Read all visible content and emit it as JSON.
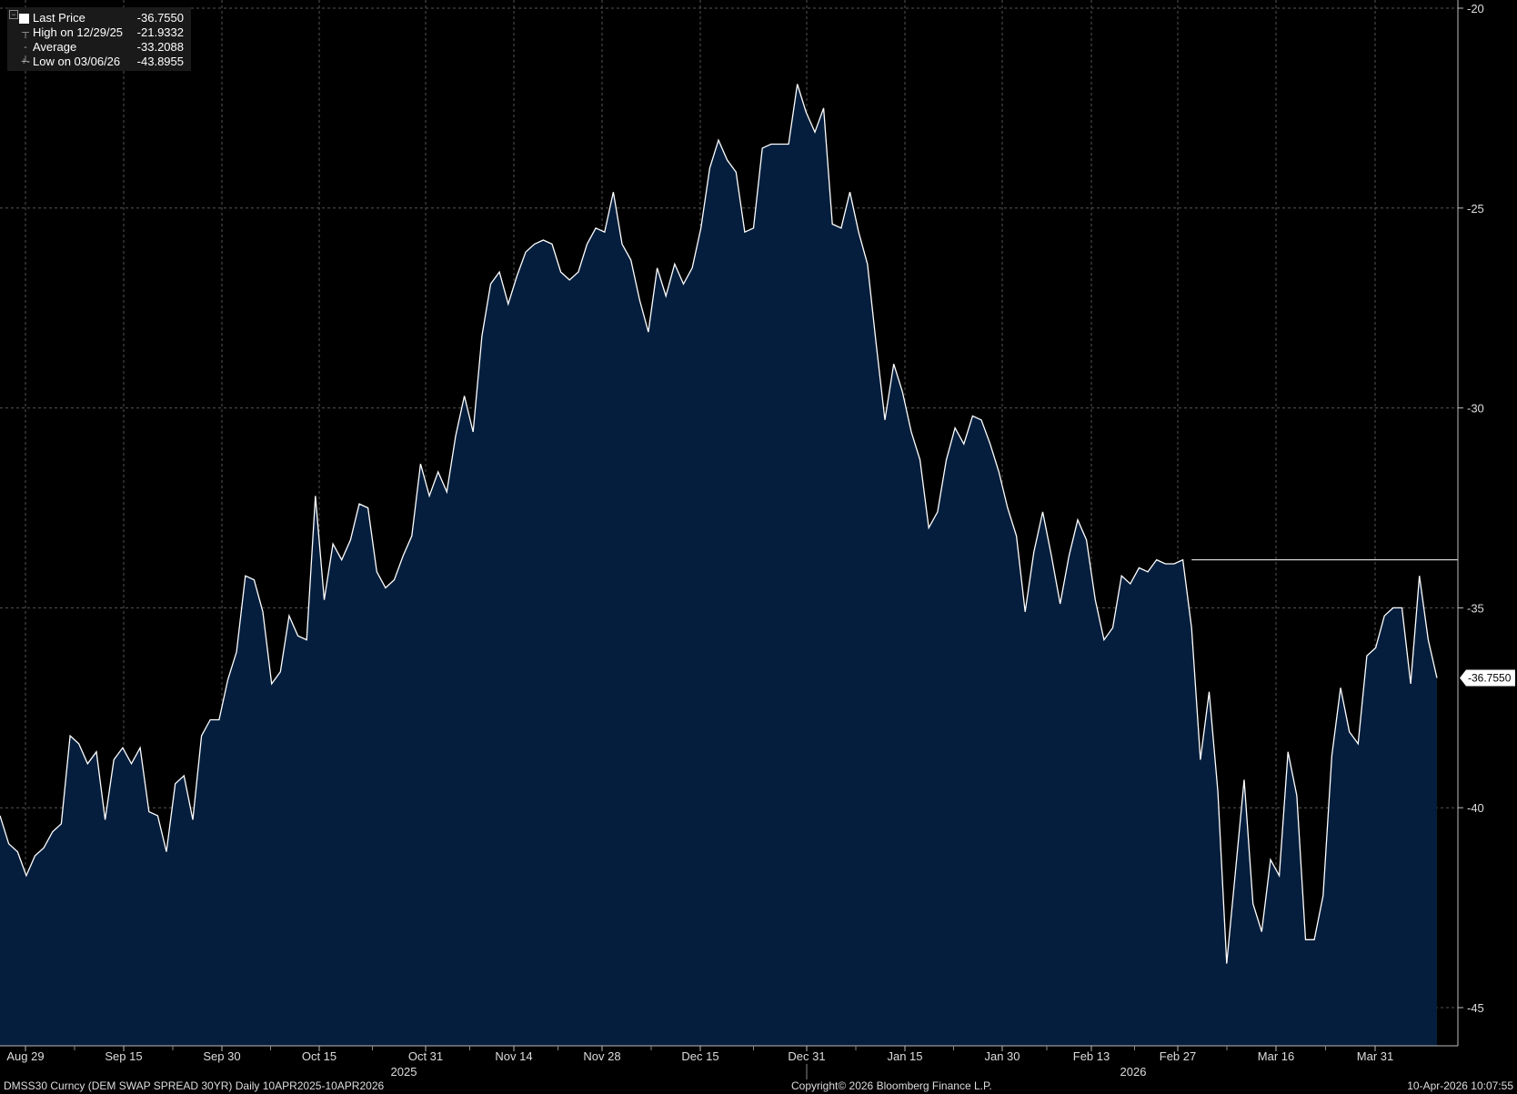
{
  "legend": {
    "last_label": "Last Price",
    "last_value": "-36.7550",
    "high_label": "High on 12/29/25",
    "high_value": "-21.9332",
    "avg_label": "Average",
    "avg_value": "-33.2088",
    "low_label": "Low on 03/06/26",
    "low_value": "-43.8955"
  },
  "footer": {
    "left": "DMSS30 Curncy (DEM SWAP SPREAD    30YR) Daily 10APR2025-10APR2026",
    "center": "Copyright© 2026 Bloomberg Finance L.P.",
    "right": "10-Apr-2026 10:07:55"
  },
  "colors": {
    "background": "#000000",
    "area_fill": "#051e3d",
    "line": "#ffffff",
    "grid": "#555555"
  },
  "chart_data": {
    "type": "area",
    "x_tick_labels": [
      "Aug 29",
      "Sep 15",
      "Sep 30",
      "Oct 15",
      "Oct 31",
      "Nov 14",
      "Nov 28",
      "Dec 15",
      "Dec 31",
      "Jan 15",
      "Jan 30",
      "Feb 13",
      "Feb 27",
      "Mar 16",
      "Mar 31"
    ],
    "year_labels": [
      "2025",
      "2026"
    ],
    "y_ticks": [
      -20,
      -25,
      -30,
      -35,
      -40,
      -45
    ],
    "y_tick_labels": [
      "-20",
      "-25",
      "-30",
      "-35",
      "-40",
      "-45"
    ],
    "ylim": [
      -46,
      -20
    ],
    "grid": true,
    "legend_position": "top-left",
    "last_price_label": "-36.7550",
    "reference_level": -33.8,
    "series": [
      {
        "name": "Last Price",
        "values": [
          -40.2,
          -40.9,
          -41.1,
          -41.7,
          -41.2,
          -41.0,
          -40.6,
          -40.4,
          -38.2,
          -38.4,
          -38.9,
          -38.6,
          -40.3,
          -38.8,
          -38.5,
          -38.9,
          -38.5,
          -40.1,
          -40.2,
          -41.1,
          -39.4,
          -39.2,
          -40.3,
          -38.2,
          -37.8,
          -37.8,
          -36.8,
          -36.1,
          -34.2,
          -34.3,
          -35.1,
          -36.9,
          -36.6,
          -35.2,
          -35.7,
          -35.8,
          -32.2,
          -34.8,
          -33.4,
          -33.8,
          -33.3,
          -32.4,
          -32.5,
          -34.1,
          -34.5,
          -34.3,
          -33.7,
          -33.2,
          -31.4,
          -32.2,
          -31.6,
          -32.1,
          -30.7,
          -29.7,
          -30.6,
          -28.2,
          -26.9,
          -26.6,
          -27.4,
          -26.7,
          -26.1,
          -25.9,
          -25.8,
          -25.9,
          -26.6,
          -26.8,
          -26.6,
          -25.9,
          -25.5,
          -25.6,
          -24.6,
          -25.9,
          -26.3,
          -27.3,
          -28.1,
          -26.5,
          -27.2,
          -26.4,
          -26.9,
          -26.5,
          -25.5,
          -24.0,
          -23.3,
          -23.8,
          -24.1,
          -25.6,
          -25.5,
          -23.5,
          -23.4,
          -23.4,
          -23.4,
          -21.9,
          -22.6,
          -23.1,
          -22.5,
          -25.4,
          -25.5,
          -24.6,
          -25.6,
          -26.4,
          -28.4,
          -30.3,
          -28.9,
          -29.6,
          -30.6,
          -31.3,
          -33.0,
          -32.6,
          -31.3,
          -30.5,
          -30.9,
          -30.2,
          -30.3,
          -30.9,
          -31.6,
          -32.5,
          -33.2,
          -35.1,
          -33.6,
          -32.6,
          -33.7,
          -34.9,
          -33.7,
          -32.8,
          -33.3,
          -34.8,
          -35.8,
          -35.5,
          -34.2,
          -34.4,
          -34.0,
          -34.1,
          -33.8,
          -33.9,
          -33.9,
          -33.8,
          -35.5,
          -38.8,
          -37.1,
          -39.6,
          -43.9,
          -41.6,
          -39.3,
          -42.4,
          -43.1,
          -41.3,
          -41.7,
          -38.6,
          -39.7,
          -43.3,
          -43.3,
          -42.2,
          -38.7,
          -37.0,
          -38.1,
          -38.4,
          -36.2,
          -36.0,
          -35.2,
          -35.0,
          -35.0,
          -36.9,
          -34.2,
          -35.8,
          -36.755
        ]
      }
    ]
  }
}
